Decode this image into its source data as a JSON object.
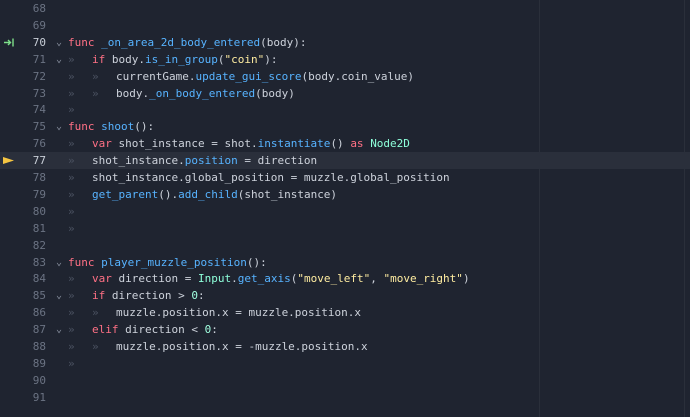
{
  "tab_glyph": "»",
  "fold_glyph": "⌄",
  "lines": [
    {
      "num": "68",
      "marker": "",
      "fold": false,
      "current": false,
      "indent": 0,
      "tokens": []
    },
    {
      "num": "69",
      "marker": "",
      "fold": false,
      "current": false,
      "indent": 0,
      "tokens": []
    },
    {
      "num": "70",
      "marker": "arrow",
      "fold": true,
      "current": false,
      "indent": 0,
      "tokens": [
        {
          "t": "func ",
          "c": "kw"
        },
        {
          "t": "_on_area_2d_body_entered",
          "c": "fn"
        },
        {
          "t": "(body):",
          "c": "plain"
        }
      ]
    },
    {
      "num": "71",
      "marker": "",
      "fold": true,
      "current": false,
      "indent": 1,
      "tokens": [
        {
          "t": "if ",
          "c": "kw"
        },
        {
          "t": "body.",
          "c": "plain"
        },
        {
          "t": "is_in_group",
          "c": "fn"
        },
        {
          "t": "(",
          "c": "plain"
        },
        {
          "t": "\"coin\"",
          "c": "str"
        },
        {
          "t": "):",
          "c": "plain"
        }
      ]
    },
    {
      "num": "72",
      "marker": "",
      "fold": false,
      "current": false,
      "indent": 2,
      "tokens": [
        {
          "t": "currentGame.",
          "c": "plain"
        },
        {
          "t": "update_gui_score",
          "c": "fn"
        },
        {
          "t": "(body.coin_value)",
          "c": "plain"
        }
      ]
    },
    {
      "num": "73",
      "marker": "",
      "fold": false,
      "current": false,
      "indent": 2,
      "tokens": [
        {
          "t": "body.",
          "c": "plain"
        },
        {
          "t": "_on_body_entered",
          "c": "fn"
        },
        {
          "t": "(body)",
          "c": "plain"
        }
      ]
    },
    {
      "num": "74",
      "marker": "",
      "fold": false,
      "current": false,
      "indent": 1,
      "tokens": []
    },
    {
      "num": "75",
      "marker": "",
      "fold": true,
      "current": false,
      "indent": 0,
      "tokens": [
        {
          "t": "func ",
          "c": "kw"
        },
        {
          "t": "shoot",
          "c": "fn"
        },
        {
          "t": "():",
          "c": "plain"
        }
      ]
    },
    {
      "num": "76",
      "marker": "",
      "fold": false,
      "current": false,
      "indent": 1,
      "tokens": [
        {
          "t": "var ",
          "c": "kw"
        },
        {
          "t": "shot_instance = shot.",
          "c": "plain"
        },
        {
          "t": "instantiate",
          "c": "fn"
        },
        {
          "t": "() ",
          "c": "plain"
        },
        {
          "t": "as ",
          "c": "kw"
        },
        {
          "t": "Node2D",
          "c": "type"
        }
      ]
    },
    {
      "num": "77",
      "marker": "breakpoint",
      "fold": false,
      "current": true,
      "indent": 1,
      "tokens": [
        {
          "t": "shot_instance.",
          "c": "plain"
        },
        {
          "t": "position",
          "c": "fn"
        },
        {
          "t": " = direction",
          "c": "plain"
        }
      ]
    },
    {
      "num": "78",
      "marker": "",
      "fold": false,
      "current": false,
      "indent": 1,
      "tokens": [
        {
          "t": "shot_instance.global_position = muzzle.global_position",
          "c": "plain"
        }
      ]
    },
    {
      "num": "79",
      "marker": "",
      "fold": false,
      "current": false,
      "indent": 1,
      "tokens": [
        {
          "t": "get_parent",
          "c": "fn"
        },
        {
          "t": "().",
          "c": "plain"
        },
        {
          "t": "add_child",
          "c": "fn"
        },
        {
          "t": "(shot_instance)",
          "c": "plain"
        }
      ]
    },
    {
      "num": "80",
      "marker": "",
      "fold": false,
      "current": false,
      "indent": 1,
      "tokens": []
    },
    {
      "num": "81",
      "marker": "",
      "fold": false,
      "current": false,
      "indent": 1,
      "tokens": []
    },
    {
      "num": "82",
      "marker": "",
      "fold": false,
      "current": false,
      "indent": 0,
      "tokens": []
    },
    {
      "num": "83",
      "marker": "",
      "fold": true,
      "current": false,
      "indent": 0,
      "tokens": [
        {
          "t": "func ",
          "c": "kw"
        },
        {
          "t": "player_muzzle_position",
          "c": "fn"
        },
        {
          "t": "():",
          "c": "plain"
        }
      ]
    },
    {
      "num": "84",
      "marker": "",
      "fold": false,
      "current": false,
      "indent": 1,
      "tokens": [
        {
          "t": "var ",
          "c": "kw"
        },
        {
          "t": "direction = ",
          "c": "plain"
        },
        {
          "t": "Input",
          "c": "type"
        },
        {
          "t": ".",
          "c": "plain"
        },
        {
          "t": "get_axis",
          "c": "fn"
        },
        {
          "t": "(",
          "c": "plain"
        },
        {
          "t": "\"move_left\"",
          "c": "str"
        },
        {
          "t": ", ",
          "c": "plain"
        },
        {
          "t": "\"move_right\"",
          "c": "str"
        },
        {
          "t": ")",
          "c": "plain"
        }
      ]
    },
    {
      "num": "85",
      "marker": "",
      "fold": true,
      "current": false,
      "indent": 1,
      "tokens": [
        {
          "t": "if ",
          "c": "kw"
        },
        {
          "t": "direction > ",
          "c": "plain"
        },
        {
          "t": "0",
          "c": "num"
        },
        {
          "t": ":",
          "c": "plain"
        }
      ]
    },
    {
      "num": "86",
      "marker": "",
      "fold": false,
      "current": false,
      "indent": 2,
      "tokens": [
        {
          "t": "muzzle.position.x = muzzle.position.x",
          "c": "plain"
        }
      ]
    },
    {
      "num": "87",
      "marker": "",
      "fold": true,
      "current": false,
      "indent": 1,
      "tokens": [
        {
          "t": "elif ",
          "c": "kw"
        },
        {
          "t": "direction < ",
          "c": "plain"
        },
        {
          "t": "0",
          "c": "num"
        },
        {
          "t": ":",
          "c": "plain"
        }
      ]
    },
    {
      "num": "88",
      "marker": "",
      "fold": false,
      "current": false,
      "indent": 2,
      "tokens": [
        {
          "t": "muzzle.position.x = -muzzle.position.x",
          "c": "plain"
        }
      ]
    },
    {
      "num": "89",
      "marker": "",
      "fold": false,
      "current": false,
      "indent": 1,
      "tokens": []
    },
    {
      "num": "90",
      "marker": "",
      "fold": false,
      "current": false,
      "indent": 0,
      "tokens": []
    },
    {
      "num": "91",
      "marker": "",
      "fold": false,
      "current": false,
      "indent": 0,
      "tokens": []
    }
  ]
}
